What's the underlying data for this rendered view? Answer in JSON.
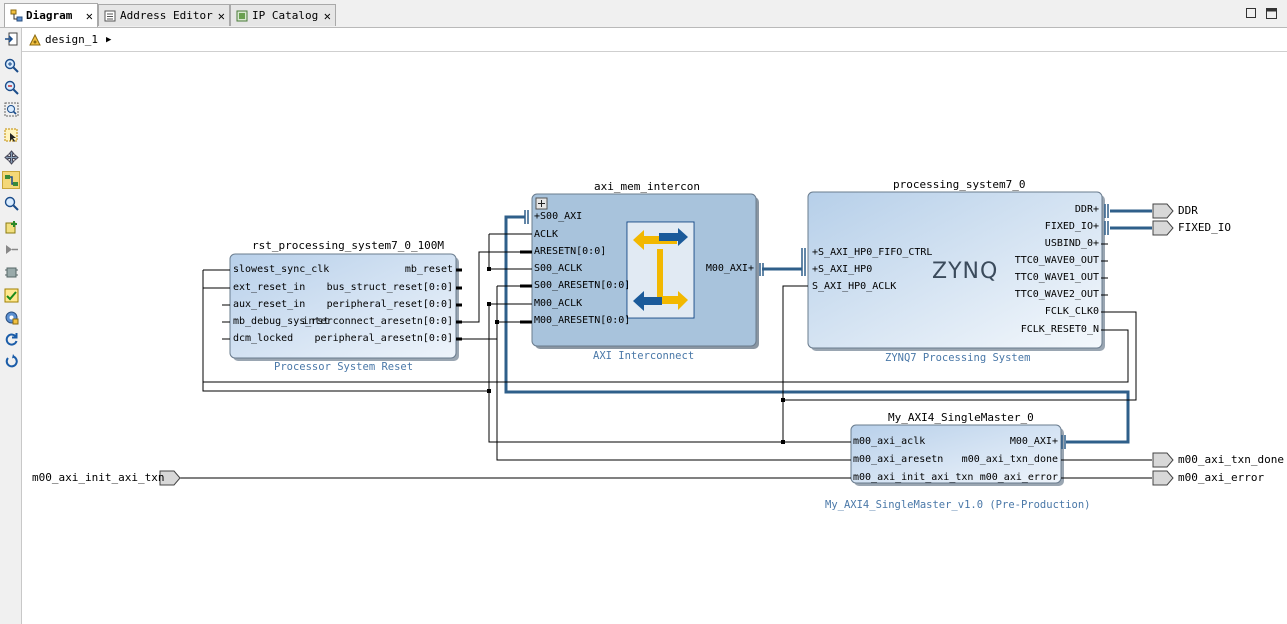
{
  "tabs": [
    {
      "label": "Diagram",
      "icon": "diagram-icon"
    },
    {
      "label": "Address Editor",
      "icon": "address-editor-icon"
    },
    {
      "label": "IP Catalog",
      "icon": "ip-catalog-icon"
    }
  ],
  "breadcrumb": {
    "label": "design_1"
  },
  "colors": {
    "block_fill": "#c8dcf0",
    "interconnect_fill": "#a8c4dc",
    "wire": "#000000",
    "bus": "#2f5f8a",
    "subtitle": "#4a78a8",
    "selected_tool": "#f4d878"
  },
  "toolbar_icons": [
    "fit-window-icon",
    "zoom-in-icon",
    "zoom-out-icon",
    "zoom-fit-icon",
    "select-area-icon",
    "move-icon",
    "autoroute-icon",
    "search-icon",
    "add-ip-icon",
    "make-external-icon",
    "add-module-icon",
    "validate-icon",
    "regenerate-icon",
    "refresh-icon",
    "undo-icon"
  ],
  "blocks": {
    "rst": {
      "title": "rst_processing_system7_0_100M",
      "subtitle": "Processor System Reset",
      "inputs": [
        "slowest_sync_clk",
        "ext_reset_in",
        "aux_reset_in",
        "mb_debug_sys_rst",
        "dcm_locked"
      ],
      "outputs": [
        "mb_reset",
        "bus_struct_reset[0:0]",
        "peripheral_reset[0:0]",
        "interconnect_aresetn[0:0]",
        "peripheral_aresetn[0:0]"
      ]
    },
    "intercon": {
      "title": "axi_mem_intercon",
      "subtitle": "AXI Interconnect",
      "inputs": [
        "S00_AXI",
        "ACLK",
        "ARESETN[0:0]",
        "S00_ACLK",
        "S00_ARESETN[0:0]",
        "M00_ACLK",
        "M00_ARESETN[0:0]"
      ],
      "outputs": [
        "M00_AXI"
      ]
    },
    "ps7": {
      "title": "processing_system7_0",
      "subtitle": "ZYNQ7 Processing System",
      "logo": "ZYNQ",
      "inputs": [
        "S_AXI_HP0_FIFO_CTRL",
        "S_AXI_HP0",
        "S_AXI_HP0_ACLK"
      ],
      "outputs": [
        "DDR",
        "FIXED_IO",
        "USBIND_0",
        "TTC0_WAVE0_OUT",
        "TTC0_WAVE1_OUT",
        "TTC0_WAVE2_OUT",
        "FCLK_CLK0",
        "FCLK_RESET0_N"
      ]
    },
    "master": {
      "title": "My_AXI4_SingleMaster_0",
      "subtitle": "My_AXI4_SingleMaster_v1.0 (Pre-Production)",
      "inputs": [
        "m00_axi_aclk",
        "m00_axi_aresetn",
        "m00_axi_init_axi_txn"
      ],
      "outputs": [
        "M00_AXI",
        "m00_axi_txn_done",
        "m00_axi_error"
      ]
    }
  },
  "ports": {
    "ddr": "DDR",
    "fixed_io": "FIXED_IO",
    "init_txn": "m00_axi_init_axi_txn",
    "txn_done": "m00_axi_txn_done",
    "error": "m00_axi_error"
  }
}
